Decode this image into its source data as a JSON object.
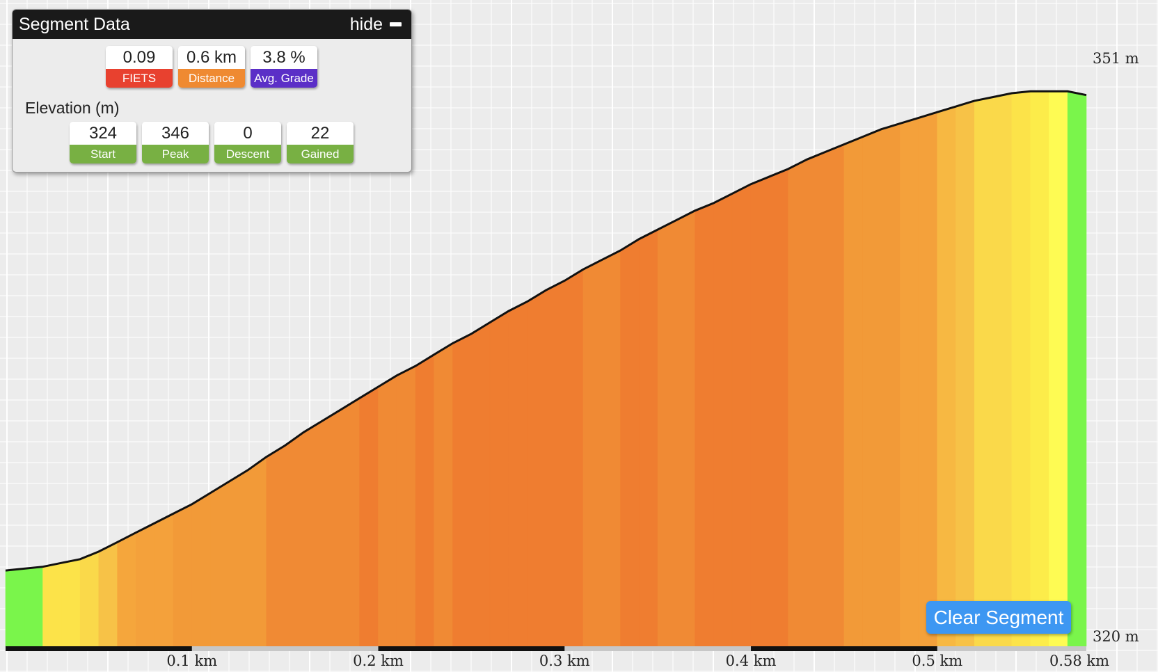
{
  "panel": {
    "title": "Segment Data",
    "hide_label": "hide",
    "elevation_title": "Elevation (m)"
  },
  "summary": [
    {
      "value": "0.09",
      "label": "FIETS",
      "color": "#e8412f"
    },
    {
      "value": "0.6 km",
      "label": "Distance",
      "color": "#ef8a32"
    },
    {
      "value": "3.8 %",
      "label": "Avg. Grade",
      "color": "#5b2fc7"
    }
  ],
  "elevation": [
    {
      "value": "324",
      "label": "Start",
      "color": "#78b043"
    },
    {
      "value": "346",
      "label": "Peak",
      "color": "#78b043"
    },
    {
      "value": "0",
      "label": "Descent",
      "color": "#78b043"
    },
    {
      "value": "22",
      "label": "Gained",
      "color": "#78b043"
    }
  ],
  "clear_button": "Clear Segment",
  "chart_data": {
    "type": "area",
    "y_axis_labels": [
      "351 m",
      "320 m"
    ],
    "ylim": [
      320,
      351
    ],
    "xlim": [
      0,
      0.58
    ],
    "x_tick_labels": [
      {
        "x": 0.1,
        "label": "0.1 km"
      },
      {
        "x": 0.2,
        "label": "0.2 km"
      },
      {
        "x": 0.3,
        "label": "0.3 km"
      },
      {
        "x": 0.4,
        "label": "0.4 km"
      },
      {
        "x": 0.5,
        "label": "0.5 km"
      },
      {
        "x": 0.58,
        "label": "0.58 km"
      }
    ],
    "x": [
      0,
      0.01,
      0.02,
      0.03,
      0.04,
      0.05,
      0.06,
      0.07,
      0.08,
      0.09,
      0.1,
      0.11,
      0.12,
      0.13,
      0.14,
      0.15,
      0.16,
      0.17,
      0.18,
      0.19,
      0.2,
      0.21,
      0.22,
      0.23,
      0.24,
      0.25,
      0.26,
      0.27,
      0.28,
      0.29,
      0.3,
      0.31,
      0.32,
      0.33,
      0.34,
      0.35,
      0.36,
      0.37,
      0.38,
      0.39,
      0.4,
      0.41,
      0.42,
      0.43,
      0.44,
      0.45,
      0.46,
      0.47,
      0.48,
      0.49,
      0.5,
      0.51,
      0.52,
      0.53,
      0.54,
      0.55,
      0.56,
      0.57,
      0.58
    ],
    "elevation_m": [
      324.0,
      324.1,
      324.2,
      324.4,
      324.6,
      325.0,
      325.5,
      326.0,
      326.5,
      327.0,
      327.5,
      328.1,
      328.7,
      329.3,
      330.0,
      330.6,
      331.3,
      331.9,
      332.5,
      333.1,
      333.7,
      334.3,
      334.8,
      335.4,
      336.0,
      336.5,
      337.1,
      337.7,
      338.2,
      338.8,
      339.3,
      339.9,
      340.4,
      340.9,
      341.5,
      342.0,
      342.5,
      343.0,
      343.4,
      343.9,
      344.4,
      344.8,
      345.2,
      345.7,
      346.1,
      346.5,
      346.9,
      347.3,
      347.6,
      347.9,
      348.2,
      348.5,
      348.8,
      349.0,
      349.2,
      349.3,
      349.3,
      349.3,
      349.1
    ],
    "grade_colors": [
      "#7af54b",
      "#7af54b",
      "#fce349",
      "#fce349",
      "#fad94a",
      "#f7c247",
      "#f5a63c",
      "#f4a13b",
      "#f4a13b",
      "#f29a38",
      "#f29a38",
      "#f29a38",
      "#f29a38",
      "#f29a38",
      "#f08a34",
      "#f08a34",
      "#f08a34",
      "#f08a34",
      "#f08a34",
      "#ef7d30",
      "#f08a34",
      "#f08a34",
      "#ef7d30",
      "#f08a34",
      "#ef7d30",
      "#ef7d30",
      "#ef7d30",
      "#ef7d30",
      "#ef7d30",
      "#ef7d30",
      "#ef7d30",
      "#f08a34",
      "#f08a34",
      "#ef7d30",
      "#ef7d30",
      "#f08a34",
      "#f08a34",
      "#ef7d30",
      "#ef7d30",
      "#ef7d30",
      "#ef7d30",
      "#ef7d30",
      "#f08a34",
      "#f08a34",
      "#f08a34",
      "#f29a38",
      "#f29a38",
      "#f29a38",
      "#f4a13b",
      "#f4a13b",
      "#f7b842",
      "#f7c247",
      "#fad94a",
      "#fad94a",
      "#fce349",
      "#fcec4a",
      "#fefb53",
      "#7af54b"
    ]
  }
}
